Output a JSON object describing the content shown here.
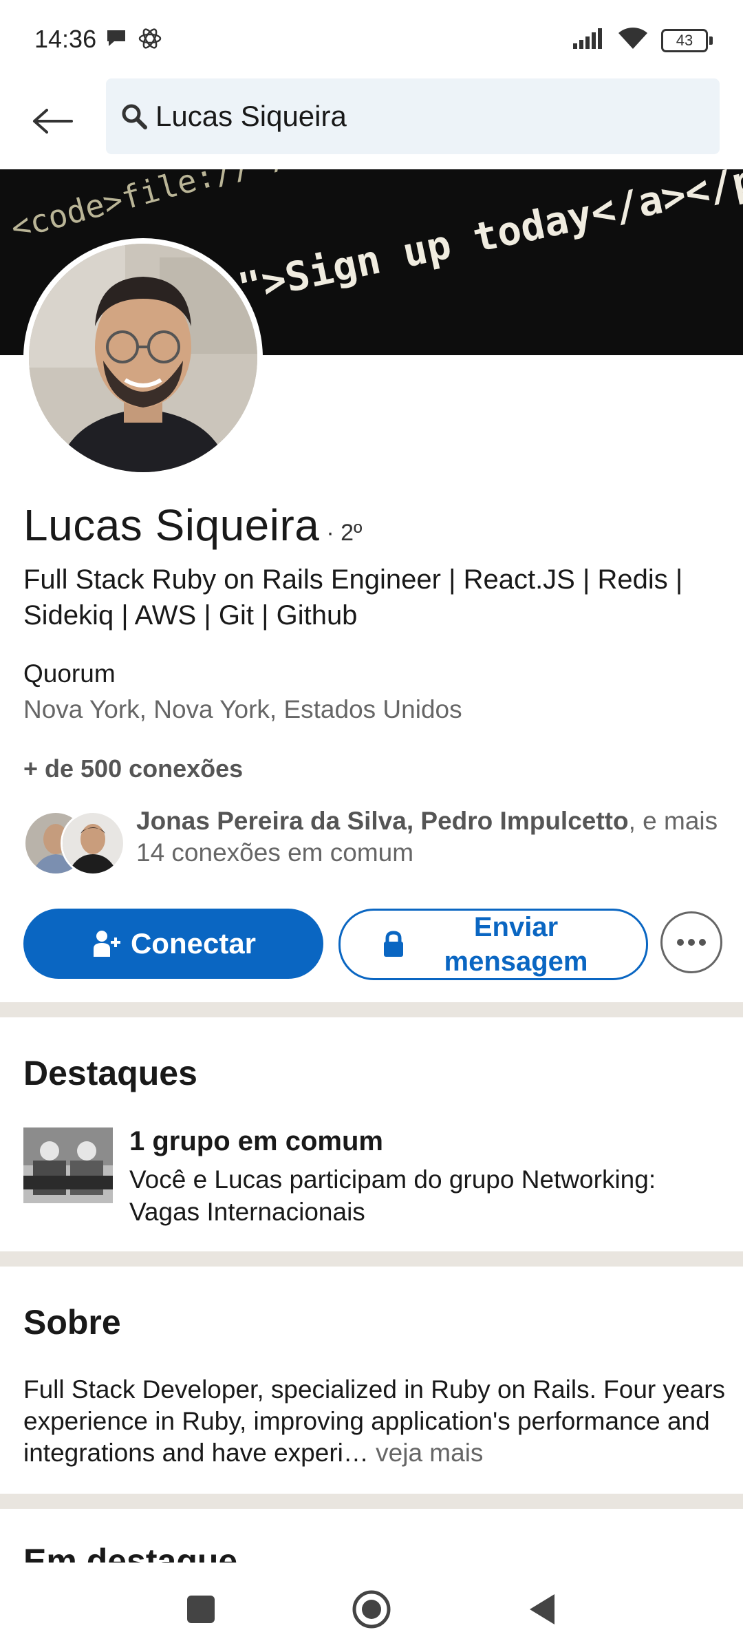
{
  "status_bar": {
    "time": "14:36",
    "battery": "43",
    "icons": [
      "chat-bubble-icon",
      "atom-icon",
      "signal-icon",
      "wifi-icon",
      "battery-icon"
    ]
  },
  "search": {
    "query": "Lucas Siqueira"
  },
  "banner": {
    "code_line_1": "<code>file://</code>",
    "code_line_2": "\">Sign up today</a></p>"
  },
  "profile": {
    "name": "Lucas Siqueira",
    "degree": "· 2º",
    "headline": "Full Stack Ruby on Rails Engineer | React.JS | Redis | Sidekiq | AWS | Git | Github",
    "company": "Quorum",
    "location": "Nova York, Nova York, Estados Unidos",
    "connections": "+ de 500 conexões"
  },
  "mutual": {
    "names": "Jonas Pereira da Silva, Pedro Impulcetto",
    "suffix": ", e mais",
    "count_text": "14 conexões em comum"
  },
  "actions": {
    "connect_label": "Conectar",
    "message_label": "Enviar mensagem"
  },
  "highlights": {
    "title": "Destaques",
    "item_title": "1 grupo em comum",
    "item_desc": "Você e Lucas participam do grupo Networking: Vagas Internacionais"
  },
  "about": {
    "title": "Sobre",
    "text": "Full Stack Developer, specialized in Ruby on Rails. Four years experience in Ruby, improving application's performance and integrations and have experi…",
    "see_more": "veja mais"
  },
  "featured": {
    "title": "Em destaque"
  },
  "colors": {
    "primary": "#0a66c2",
    "divider": "#e9e5df",
    "search_bg": "#edf3f8"
  }
}
